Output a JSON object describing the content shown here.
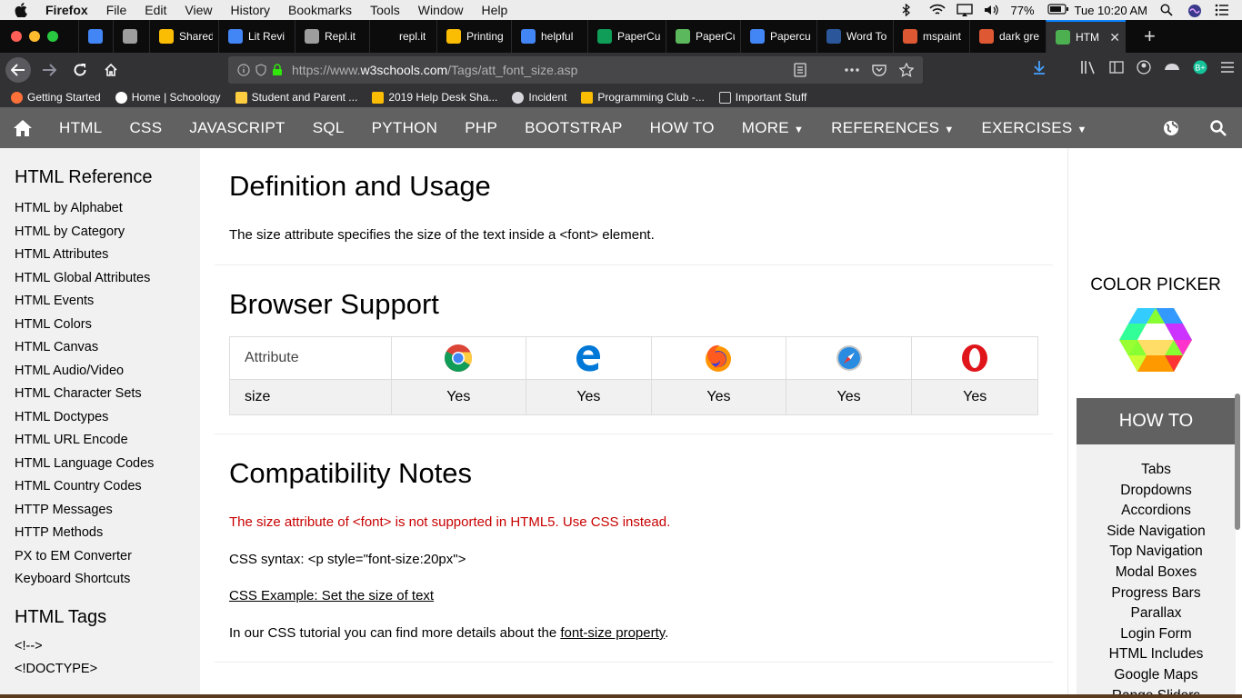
{
  "menubar": {
    "app": "Firefox",
    "items": [
      "File",
      "Edit",
      "View",
      "History",
      "Bookmarks",
      "Tools",
      "Window",
      "Help"
    ],
    "battery": "77%",
    "clock": "Tue 10:20 AM"
  },
  "tabs": [
    {
      "label": "",
      "icon": "docs-icon",
      "color": "#4285f4"
    },
    {
      "label": "",
      "icon": "replit-icon",
      "color": "#9e9e9e"
    },
    {
      "label": "Shared",
      "icon": "drive-icon",
      "color": "#fbbc04"
    },
    {
      "label": "Lit Revi",
      "icon": "docs-icon",
      "color": "#4285f4"
    },
    {
      "label": "Repl.it",
      "icon": "replit-icon",
      "color": "#9e9e9e"
    },
    {
      "label": "repl.it",
      "icon": "blank-icon",
      "color": "#0c0c0d"
    },
    {
      "label": "Printing",
      "icon": "drive-icon",
      "color": "#fbbc04"
    },
    {
      "label": "helpful",
      "icon": "docs-icon",
      "color": "#4285f4"
    },
    {
      "label": "PaperCu",
      "icon": "sheets-icon",
      "color": "#0f9d58"
    },
    {
      "label": "PaperCu",
      "icon": "papercut-icon",
      "color": "#5cb85c"
    },
    {
      "label": "Papercu",
      "icon": "docs-icon",
      "color": "#4285f4"
    },
    {
      "label": "Word To",
      "icon": "gear-icon",
      "color": "#2b579a"
    },
    {
      "label": "mspaint",
      "icon": "duckduckgo-icon",
      "color": "#de5833"
    },
    {
      "label": "dark gre",
      "icon": "duckduckgo-icon",
      "color": "#de5833"
    },
    {
      "label": "HTM",
      "icon": "w3schools-icon",
      "color": "#4caf50",
      "active": true
    }
  ],
  "url": {
    "prefix": "https://www.",
    "host": "w3schools.com",
    "path": "/Tags/att_font_size.asp"
  },
  "bookmarks": [
    {
      "label": "Getting Started",
      "icon": "firefox-icon"
    },
    {
      "label": "Home | Schoology",
      "icon": "schoology-icon"
    },
    {
      "label": "Student and Parent ...",
      "icon": "bookmark-icon"
    },
    {
      "label": "2019 Help Desk Sha...",
      "icon": "drive-icon"
    },
    {
      "label": "Incident",
      "icon": "globe-icon"
    },
    {
      "label": "Programming Club -...",
      "icon": "drive-icon"
    },
    {
      "label": "Important Stuff",
      "icon": "folder-icon"
    }
  ],
  "topnav": {
    "items": [
      "HTML",
      "CSS",
      "JAVASCRIPT",
      "SQL",
      "PYTHON",
      "PHP",
      "BOOTSTRAP",
      "HOW TO"
    ],
    "dropdowns": [
      "MORE",
      "REFERENCES",
      "EXERCISES"
    ]
  },
  "sidebar": {
    "title": "HTML Reference",
    "items": [
      "HTML by Alphabet",
      "HTML by Category",
      "HTML Attributes",
      "HTML Global Attributes",
      "HTML Events",
      "HTML Colors",
      "HTML Canvas",
      "HTML Audio/Video",
      "HTML Character Sets",
      "HTML Doctypes",
      "HTML URL Encode",
      "HTML Language Codes",
      "HTML Country Codes",
      "HTTP Messages",
      "HTTP Methods",
      "PX to EM Converter",
      "Keyboard Shortcuts"
    ],
    "tags_title": "HTML Tags",
    "tags": [
      "<!-->",
      "<!DOCTYPE>"
    ]
  },
  "main": {
    "definition": {
      "title": "Definition and Usage",
      "text": "The size attribute specifies the size of the text inside a <font> element."
    },
    "support": {
      "title": "Browser Support",
      "header": "Attribute",
      "browsers": [
        "chrome-icon",
        "edge-icon",
        "firefox-icon",
        "safari-icon",
        "opera-icon"
      ],
      "row_label": "size",
      "values": [
        "Yes",
        "Yes",
        "Yes",
        "Yes",
        "Yes"
      ]
    },
    "compat": {
      "title": "Compatibility Notes",
      "warning": "The size attribute of <font> is not supported in HTML5. Use CSS instead.",
      "syntax": "CSS syntax: <p style=\"font-size:20px\">",
      "example_link": "CSS Example: Set the size of text",
      "more_pre": "In our CSS tutorial you can find more details about the ",
      "more_link": "font-size property",
      "more_post": "."
    }
  },
  "right": {
    "color_picker": "COLOR PICKER",
    "howto_title": "HOW TO",
    "howto_items": [
      "Tabs",
      "Dropdowns",
      "Accordions",
      "Side Navigation",
      "Top Navigation",
      "Modal Boxes",
      "Progress Bars",
      "Parallax",
      "Login Form",
      "HTML Includes",
      "Google Maps",
      "Range Sliders"
    ]
  }
}
